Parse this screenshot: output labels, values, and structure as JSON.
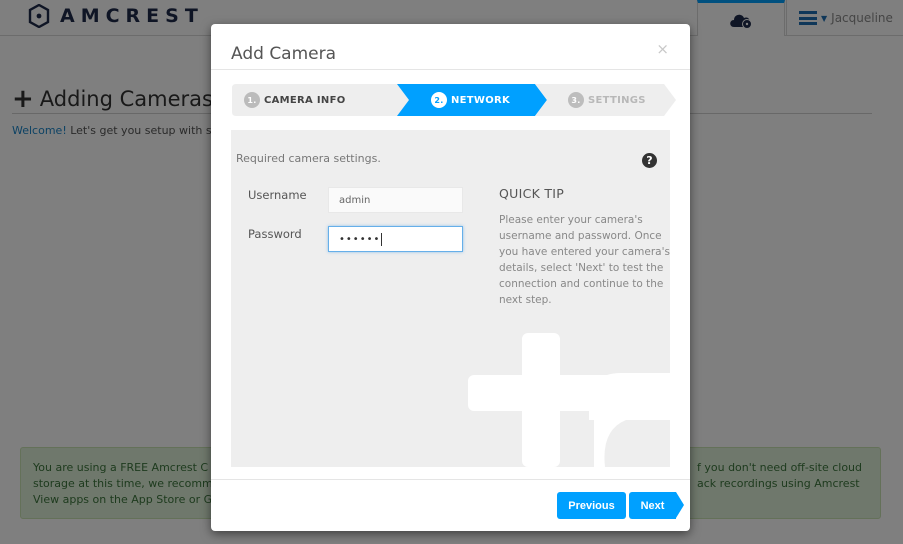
{
  "app": {
    "brand": "AMCREST",
    "user_name": "Jacqueline",
    "icons": {
      "logo": "amcrest-logo-icon",
      "cloud": "cloud-video-icon",
      "menu": "hamburger-menu-icon"
    }
  },
  "page": {
    "title": "Adding Cameras",
    "welcome_bold": "Welcome!",
    "welcome_text": " Let's get you setup with s",
    "notice_lines": [
      "You are using a FREE Amcrest C",
      "storage at this time, we recomm",
      "View apps on the App Store or G"
    ],
    "notice_right_lines": [
      "f you don't need off-site cloud",
      "ack recordings using Amcrest"
    ]
  },
  "modal": {
    "title": "Add Camera",
    "close_label": "×",
    "steps": [
      {
        "num": "1.",
        "label": "CAMERA INFO",
        "state": "complete"
      },
      {
        "num": "2.",
        "label": "NETWORK",
        "state": "active"
      },
      {
        "num": "3.",
        "label": "SETTINGS",
        "state": "upcoming"
      }
    ],
    "required_text": "Required camera settings.",
    "help_label": "?",
    "form": {
      "username_label": "Username",
      "username_value": "admin",
      "password_label": "Password",
      "password_value": "••••••"
    },
    "quick_tip": {
      "title": "QUICK TIP",
      "text": "Please enter your camera's username and password. Once you have entered your camera's details, select 'Next' to test the connection and continue to the next step."
    },
    "buttons": {
      "previous": "Previous",
      "next": "Next"
    }
  },
  "colors": {
    "accent": "#00a0ff",
    "overlay": "rgba(0,0,0,0.5)",
    "notice_bg": "#dff0d8"
  }
}
